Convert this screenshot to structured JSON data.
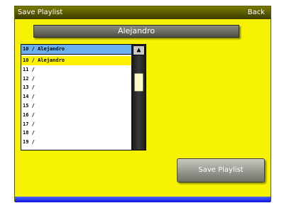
{
  "window": {
    "title": "Save Playlist",
    "back_label": "Back"
  },
  "name_bar": {
    "value": "Alejandro"
  },
  "list": {
    "header": "10 / Alejandro",
    "rows": [
      "10 / Alejandro",
      "11 /",
      "12 /",
      "13 /",
      "14 /",
      "15 /",
      "16 /",
      "17 /",
      "18 /",
      "19 /"
    ],
    "selected_index": 0
  },
  "scrollbar": {
    "up_icon": "up-arrow-icon"
  },
  "actions": {
    "save_label": "Save Playlist"
  },
  "colors": {
    "background": "#f6f200",
    "header_selection": "#6ab0f0",
    "row_selection": "#fff200",
    "bottom_strip": "#1010e0"
  }
}
